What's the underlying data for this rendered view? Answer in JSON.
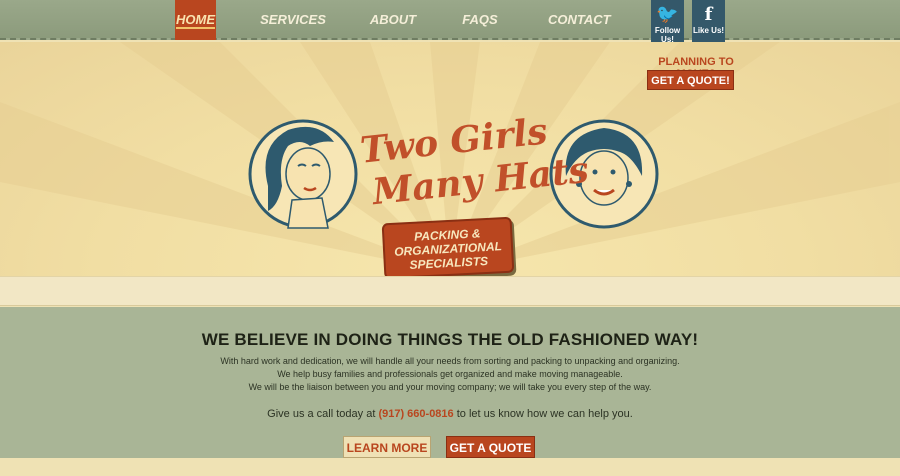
{
  "nav": {
    "items": [
      {
        "label": "HOME",
        "active": true
      },
      {
        "label": "SERVICES",
        "active": false
      },
      {
        "label": "ABOUT",
        "active": false
      },
      {
        "label": "FAQS",
        "active": false
      },
      {
        "label": "CONTACT",
        "active": false
      }
    ],
    "social": [
      {
        "icon": "twitter-icon",
        "glyph": "🐦",
        "label": "Follow Us!"
      },
      {
        "icon": "facebook-icon",
        "glyph": "f",
        "label": "Like Us!"
      }
    ]
  },
  "hero": {
    "planning_text": "PLANNING TO MOVE?",
    "get_quote_label": "GET A QUOTE!",
    "logo_line1": "Two Girls",
    "logo_line2": "Many Hats",
    "tagline_lines": [
      "PACKING &",
      "ORGANIZATIONAL",
      "SPECIALISTS"
    ]
  },
  "section": {
    "headline": "WE BELIEVE IN DOING THINGS THE OLD FASHIONED WAY!",
    "body_lines": [
      "With hard work and dedication, we will handle all your needs from sorting and packing to unpacking and organizing.",
      "We help busy families and professionals get organized and make moving manageable.",
      "We will be the liaison between you and your moving company; we will take you every step of the way."
    ],
    "call_prefix": "Give us a call today at ",
    "phone": "(917) 660-0816",
    "call_suffix": " to let us know how we can help you.",
    "learn_more_label": "LEARN MORE",
    "get_quote_label": "GET A QUOTE"
  },
  "colors": {
    "accent": "#b9461f",
    "nav_bg": "#8c9b7c",
    "hero_bg": "#f1dea3",
    "section_bg": "#a9b596",
    "portrait_blue": "#2e5a6e"
  }
}
